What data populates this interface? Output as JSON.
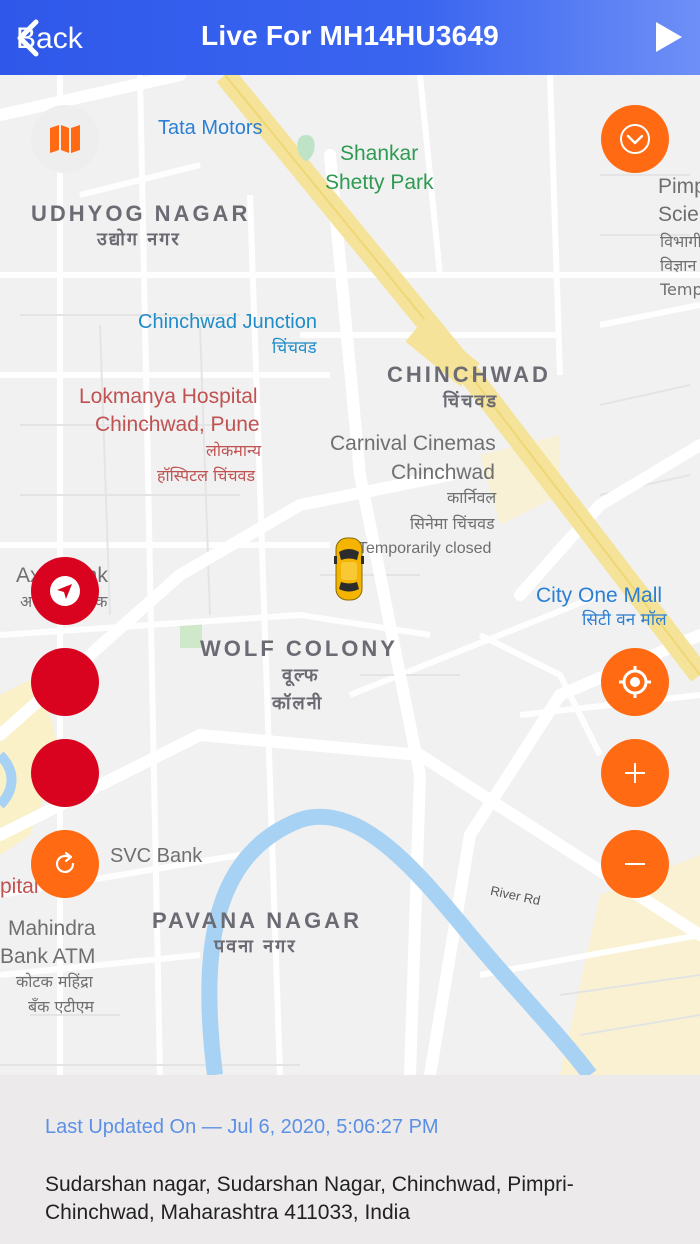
{
  "header": {
    "back_label": "Back",
    "title": "Live For MH14HU3649",
    "back_icon": "chevron-left-icon",
    "play_icon": "play-icon"
  },
  "map": {
    "labels": {
      "tata_motors": "Tata Motors",
      "shankar_park_1": "Shankar",
      "shankar_park_2": "Shetty Park",
      "pimp_1": "Pimp",
      "pimp_2": "Scie",
      "pimp_3": "विभागी",
      "pimp_4": "विज्ञान",
      "pimp_5": "Temp",
      "udhyog_nagar": "UDHYOG NAGAR",
      "udhyog_nagar_hi": "उद्योग नगर",
      "chinchwad_junction": "Chinchwad Junction",
      "chinchwad_junction_hi": "चिंचवड",
      "chinchwad": "CHINCHWAD",
      "chinchwad_hi": "चिंचवड",
      "lokmanya_1": "Lokmanya Hospital",
      "lokmanya_2": "Chinchwad, Pune",
      "lokmanya_hi_1": "लोकमान्य",
      "lokmanya_hi_2": "हॉस्पिटल चिंचवड",
      "carnival_1": "Carnival Cinemas",
      "carnival_2": "Chinchwad",
      "carnival_hi_1": "कार्निवल",
      "carnival_hi_2": "सिनेमा चिंचवड",
      "temporarily_closed": "Temporarily closed",
      "axis_bank_1": "Ax",
      "axis_bank_2": "ank",
      "axis_bank_hi": "अ",
      "axis_bank_hi_2": "बैंक",
      "city_one_mall": "City One Mall",
      "city_one_mall_hi": "सिटी वन मॉल",
      "wolf_colony": "WOLF COLONY",
      "wolf_colony_hi_1": "वूल्फ",
      "wolf_colony_hi_2": "कॉलनी",
      "svc_bank": "SVC Bank",
      "pital": "pital",
      "river_rd": "River Rd",
      "mahindra_1": "Mahindra",
      "mahindra_2": "Bank ATM",
      "mahindra_hi_1": "कोटक महिंद्रा",
      "mahindra_hi_2": "बँक एटीएम",
      "pavana_nagar": "PAVANA NAGAR",
      "pavana_nagar_hi": "पवना नगर"
    },
    "vehicle_icon": "taxi-car-icon"
  },
  "controls": {
    "map_type_icon": "map-icon",
    "collapse_icon": "chevron-down-circle-icon",
    "navigate_icon": "navigation-arrow-icon",
    "locate_icon": "crosshair-target-icon",
    "zoom_in_icon": "plus-icon",
    "zoom_out_icon": "minus-icon",
    "refresh_icon": "refresh-icon",
    "colors": {
      "orange": "#ff6a12",
      "red": "#d9031f"
    }
  },
  "footer": {
    "last_updated": "Last Updated On — Jul 6, 2020, 5:06:27 PM",
    "address": "Sudarshan nagar, Sudarshan Nagar, Chinchwad, Pimpri-Chinchwad, Maharashtra 411033, India"
  }
}
